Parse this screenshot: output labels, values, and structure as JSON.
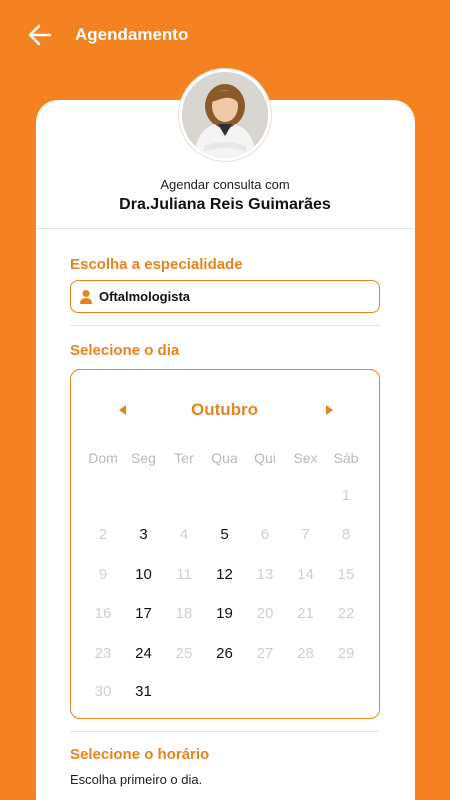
{
  "header": {
    "title": "Agendamento"
  },
  "doctor": {
    "subtitle": "Agendar consulta com",
    "name": "Dra.Juliana Reis Guimarães"
  },
  "specialty": {
    "section_title": "Escolha a especialidade",
    "value": "Oftalmologista"
  },
  "calendar": {
    "section_title": "Selecione o dia",
    "month": "Outubro",
    "weekdays": [
      "Dom",
      "Seg",
      "Ter",
      "Qua",
      "Qui",
      "Sex",
      "Sáb"
    ],
    "days": [
      {
        "label": "1",
        "available": false
      },
      {
        "label": "2",
        "available": false
      },
      {
        "label": "3",
        "available": true
      },
      {
        "label": "4",
        "available": false
      },
      {
        "label": "5",
        "available": true
      },
      {
        "label": "6",
        "available": false
      },
      {
        "label": "7",
        "available": false
      },
      {
        "label": "8",
        "available": false
      },
      {
        "label": "9",
        "available": false
      },
      {
        "label": "10",
        "available": true
      },
      {
        "label": "11",
        "available": false
      },
      {
        "label": "12",
        "available": true
      },
      {
        "label": "13",
        "available": false
      },
      {
        "label": "14",
        "available": false
      },
      {
        "label": "15",
        "available": false
      },
      {
        "label": "16",
        "available": false
      },
      {
        "label": "17",
        "available": true
      },
      {
        "label": "18",
        "available": false
      },
      {
        "label": "19",
        "available": true
      },
      {
        "label": "20",
        "available": false
      },
      {
        "label": "21",
        "available": false
      },
      {
        "label": "22",
        "available": false
      },
      {
        "label": "23",
        "available": false
      },
      {
        "label": "24",
        "available": true
      },
      {
        "label": "25",
        "available": false
      },
      {
        "label": "26",
        "available": true
      },
      {
        "label": "27",
        "available": false
      },
      {
        "label": "28",
        "available": false
      },
      {
        "label": "29",
        "available": false
      },
      {
        "label": "30",
        "available": false
      },
      {
        "label": "31",
        "available": true
      }
    ]
  },
  "time": {
    "section_title": "Selecione o horário",
    "hint": "Escolha primeiro o dia."
  },
  "colors": {
    "brand_orange": "#F58220",
    "accent_orange": "#E8841F"
  },
  "icons": {
    "back": "arrow-left-icon",
    "specialty": "person-icon",
    "prev": "caret-left-icon",
    "next": "caret-right-icon"
  }
}
